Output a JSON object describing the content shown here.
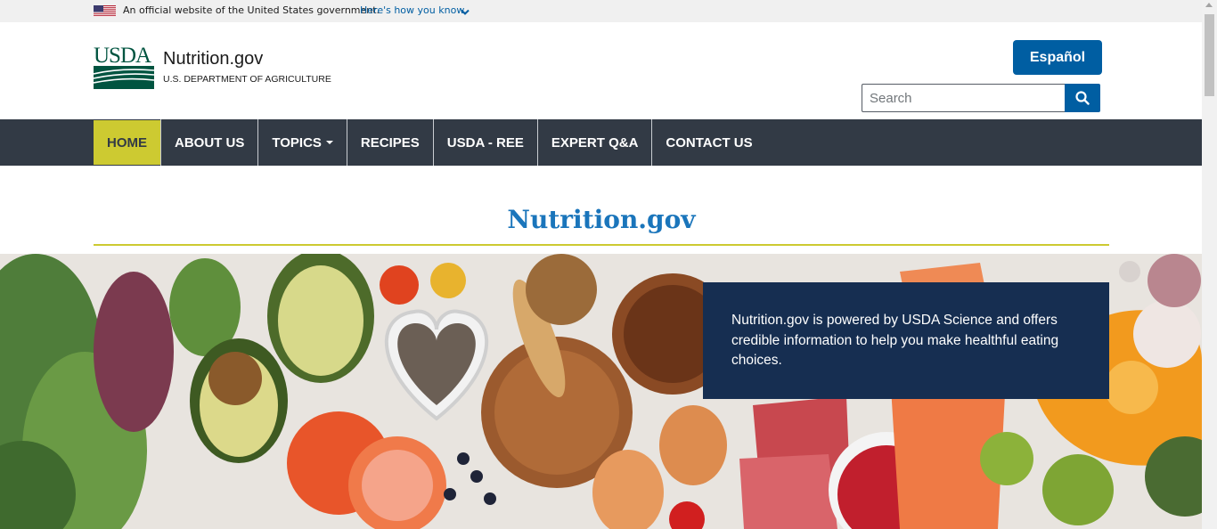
{
  "gov_banner": {
    "official_text": "An official website of the United States government.",
    "how_link": "Here's how you know.",
    "flag_icon": "us-flag-icon",
    "chevron_icon": "chevron-down-icon"
  },
  "header": {
    "logo_text": "USDA",
    "site_name": "Nutrition.gov",
    "agency_name": "U.S. DEPARTMENT OF AGRICULTURE",
    "language_button": "Español",
    "search": {
      "placeholder": "Search",
      "value": "",
      "button_icon": "search-icon"
    }
  },
  "nav": {
    "items": [
      {
        "label": "HOME",
        "active": true
      },
      {
        "label": "ABOUT US"
      },
      {
        "label": "TOPICS",
        "has_dropdown": true
      },
      {
        "label": "RECIPES"
      },
      {
        "label": "USDA - REE"
      },
      {
        "label": "EXPERT Q&A"
      },
      {
        "label": "CONTACT US"
      }
    ]
  },
  "main": {
    "title": "Nutrition.gov",
    "hero_text": "Nutrition.gov is powered by USDA Science and offers credible information to help you make healthful eating choices."
  },
  "colors": {
    "primary_blue": "#005ea2",
    "nav_bg": "#323a45",
    "nav_active": "#cdca31",
    "title_blue": "#1a75bb",
    "hero_card": "#162e51",
    "usda_green": "#005440"
  }
}
